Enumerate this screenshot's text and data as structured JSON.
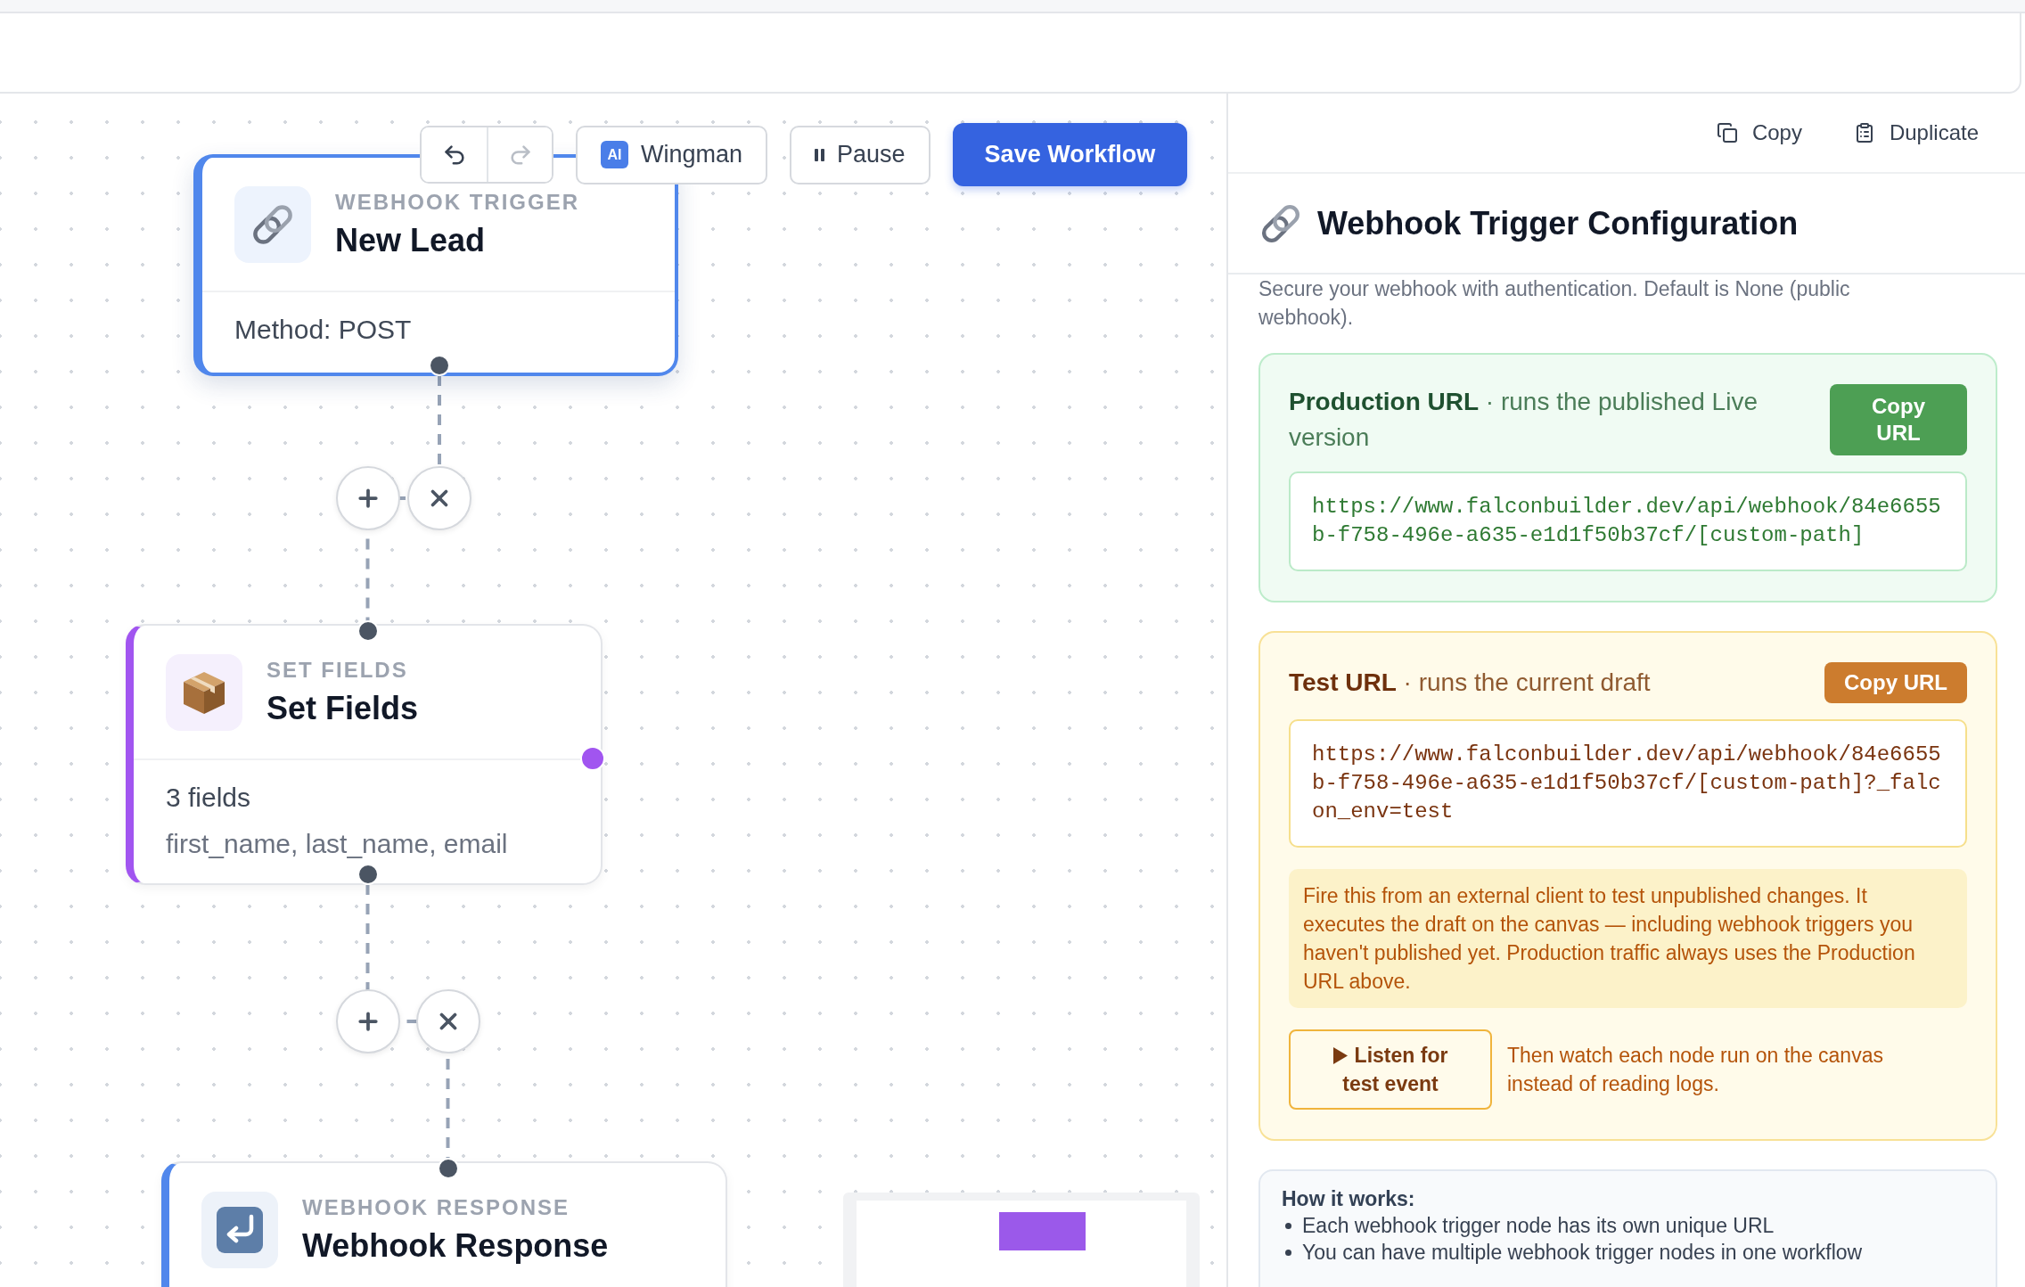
{
  "toolbar": {
    "history": [
      {
        "kind": "undo",
        "disabled": false
      },
      {
        "kind": "redo",
        "disabled": true
      }
    ],
    "wingman": {
      "badge": "AI",
      "label": "Wingman"
    },
    "pause": {
      "label": "Pause"
    },
    "save": {
      "label": "Save Workflow"
    }
  },
  "canvas": {
    "nodes": [
      {
        "kind": "trigger",
        "category": "WEBHOOK TRIGGER",
        "title": "New Lead",
        "summary": "Method: POST",
        "selected": true,
        "color": "#5087ec"
      },
      {
        "kind": "transform",
        "category": "SET FIELDS",
        "title": "Set Fields",
        "summary": "3 fields",
        "detail": "first_name, last_name, email",
        "selected": false,
        "color": "#a155f0"
      },
      {
        "kind": "response",
        "category": "WEBHOOK RESPONSE",
        "title": "Webhook Response",
        "selected": false,
        "color": "#5087ec"
      }
    ]
  },
  "panel": {
    "actions": [
      {
        "kind": "copy",
        "label": "Copy"
      },
      {
        "kind": "duplicate",
        "label": "Duplicate"
      }
    ],
    "title": "Webhook Trigger Configuration",
    "auth_hint": "Secure your webhook with authentication. Default is None (public webhook).",
    "url_cards": [
      {
        "kind": "production",
        "heading": "**Production URL** · runs the published Live version",
        "button": "Copy URL",
        "url": "https://www.falconbuilder.dev/api/webhook/84e6655b-f758-496e-a635-e1d1f50b37cf/[custom-path]"
      },
      {
        "kind": "test",
        "heading": "**Test URL** · runs the current draft",
        "button": "Copy URL",
        "url": "https://www.falconbuilder.dev/api/webhook/84e6655b-f758-496e-a635-e1d1f50b37cf/[custom-path]?_falcon_env=test",
        "note": "Fire this from an external client to test unpublished changes. It executes the draft on the canvas — including webhook triggers you haven't published yet. Production traffic always uses the Production URL above.",
        "listen_button": "Listen for test event",
        "listen_hint": "Then watch each node run on the canvas instead of reading logs."
      }
    ],
    "how_it_works": {
      "title": "How it works:",
      "items": [
        "Each webhook trigger node has its own unique URL",
        "You can have multiple webhook trigger nodes in one workflow"
      ]
    }
  }
}
